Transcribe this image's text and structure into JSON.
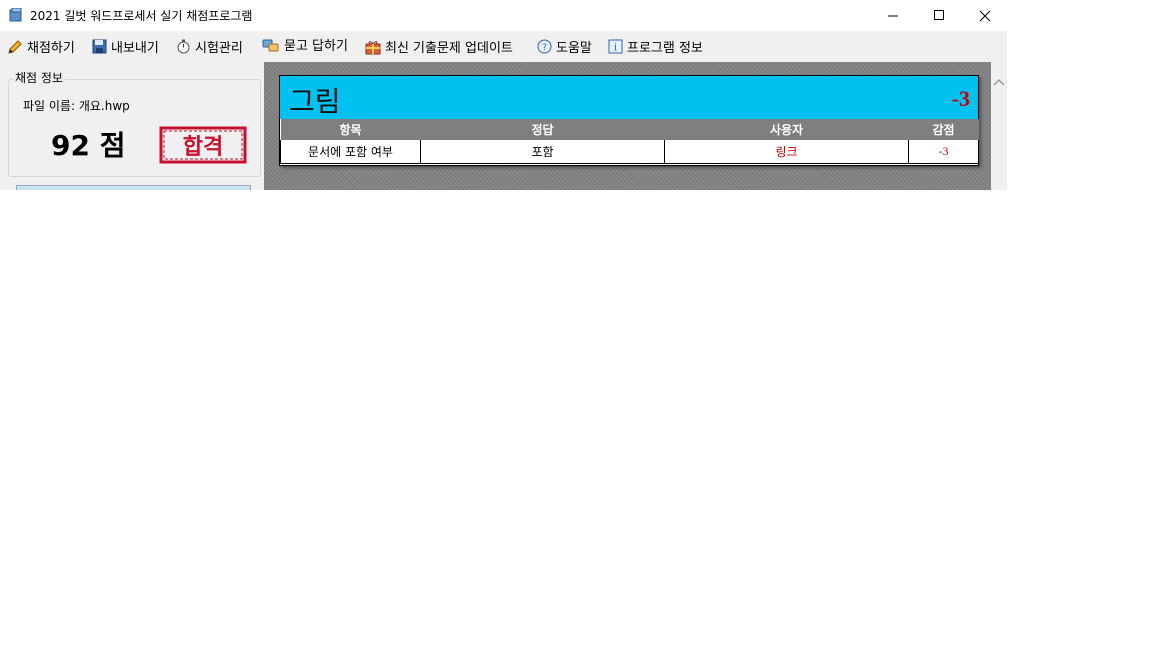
{
  "window": {
    "title": "2021 길벗 워드프로세서 실기 채점프로그램"
  },
  "menu": {
    "items": [
      {
        "label": "채점하기",
        "icon": "pencil-icon"
      },
      {
        "label": "내보내기",
        "icon": "save-icon"
      },
      {
        "label": "시험관리",
        "icon": "stopwatch-icon"
      },
      {
        "label": "묻고 답하기",
        "icon": "qa-icon"
      },
      {
        "label": "최신 기출문제 업데이트",
        "icon": "gift-icon"
      },
      {
        "label": "도움말",
        "icon": "help-icon"
      },
      {
        "label": "프로그램 정보",
        "icon": "info-icon"
      }
    ]
  },
  "grading": {
    "group_title": "채점 정보",
    "file_label": "파일 이름: 개요.hwp",
    "score": "92 점",
    "result_stamp": "합격"
  },
  "card": {
    "title": "그림",
    "deduction": "-3",
    "columns": [
      "항목",
      "정답",
      "사용자",
      "감점"
    ],
    "rows": [
      {
        "item": "문서에 포함 여부",
        "answer": "포함",
        "user": "링크",
        "deduct": "-3"
      }
    ]
  },
  "colors": {
    "header_accent": "#00c1ef",
    "error_red": "#cc0000"
  }
}
